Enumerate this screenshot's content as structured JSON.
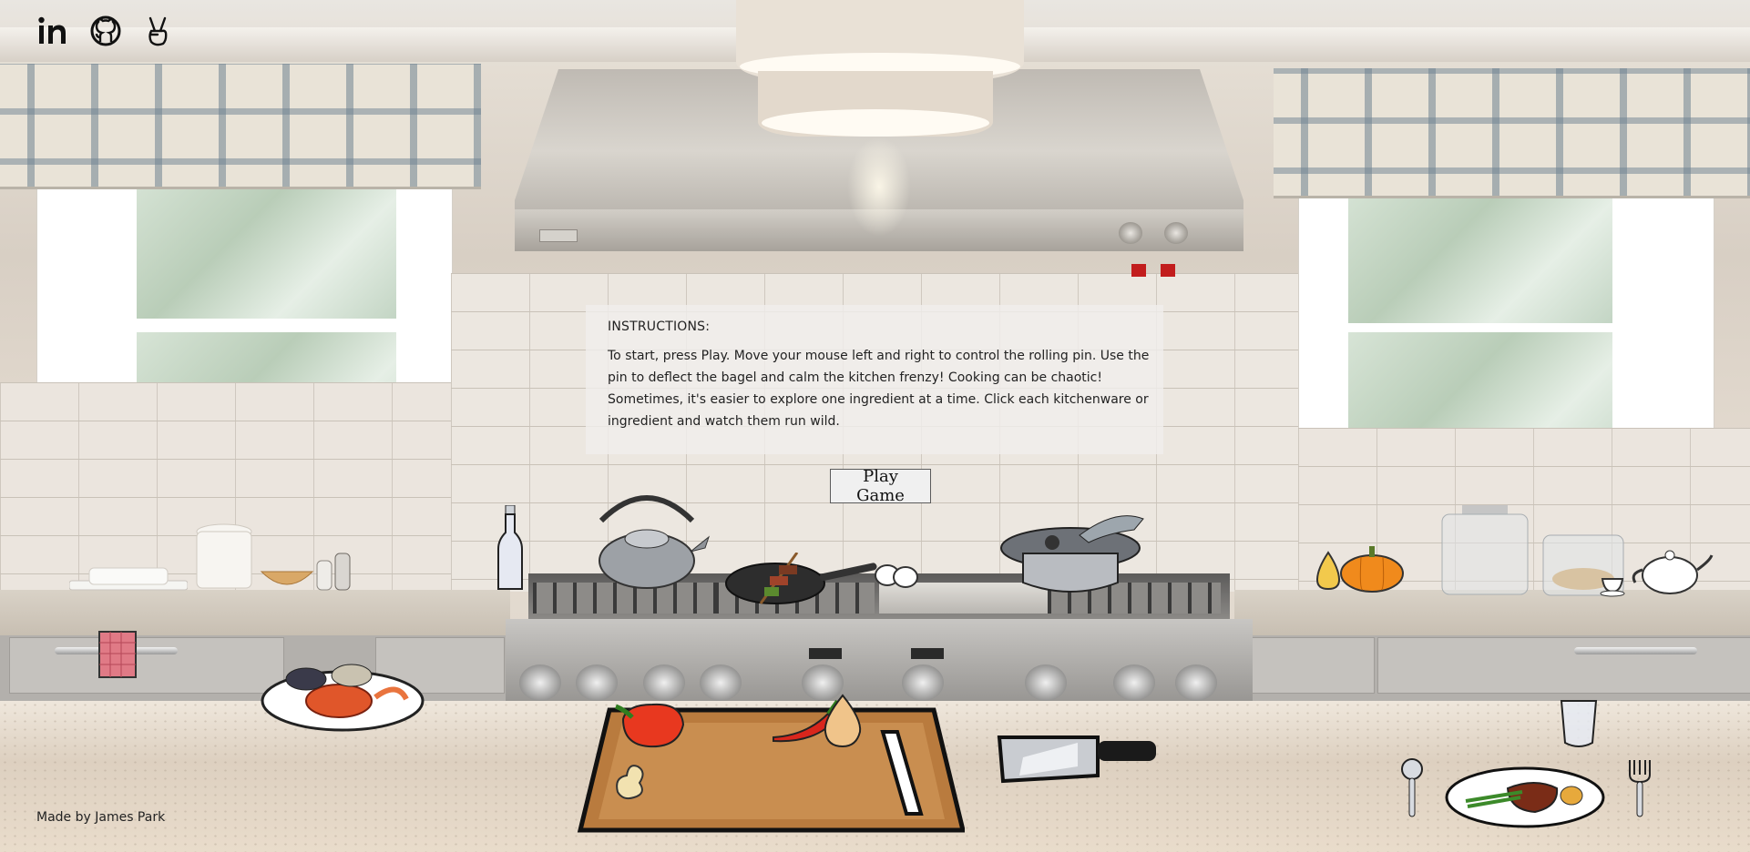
{
  "header": {
    "social_links": [
      {
        "name": "linkedin",
        "icon": "linkedin-icon"
      },
      {
        "name": "github",
        "icon": "github-icon"
      },
      {
        "name": "angellist",
        "icon": "peace-hand-icon"
      }
    ]
  },
  "instructions": {
    "title": "INSTRUCTIONS:",
    "body": "To start, press Play. Move your mouse left and right to control the rolling pin. Use the pin to deflect the bagel and calm the kitchen frenzy! Cooking can be chaotic! Sometimes, it's easier to explore one ingredient at a time. Click each kitchenware or ingredient and watch them run wild."
  },
  "play_button": {
    "label": "Play Game"
  },
  "footer": {
    "credit": "Made by James Park"
  },
  "kitchen_items": [
    "glass-bottle",
    "kettle",
    "frying-pan-with-skewer",
    "eggs",
    "fish-pot",
    "squash",
    "pumpkin",
    "teapot",
    "teacup",
    "dish-towel",
    "seafood-platter",
    "red-bell-pepper",
    "chili-pepper",
    "onion",
    "ginger",
    "cutting-board",
    "cleaver",
    "water-glass",
    "spoon",
    "steak-plate",
    "fork"
  ],
  "colors": {
    "instructions_bg": "#f0eeebd1",
    "button_bg": "#f0f0f0",
    "text": "#222222"
  }
}
